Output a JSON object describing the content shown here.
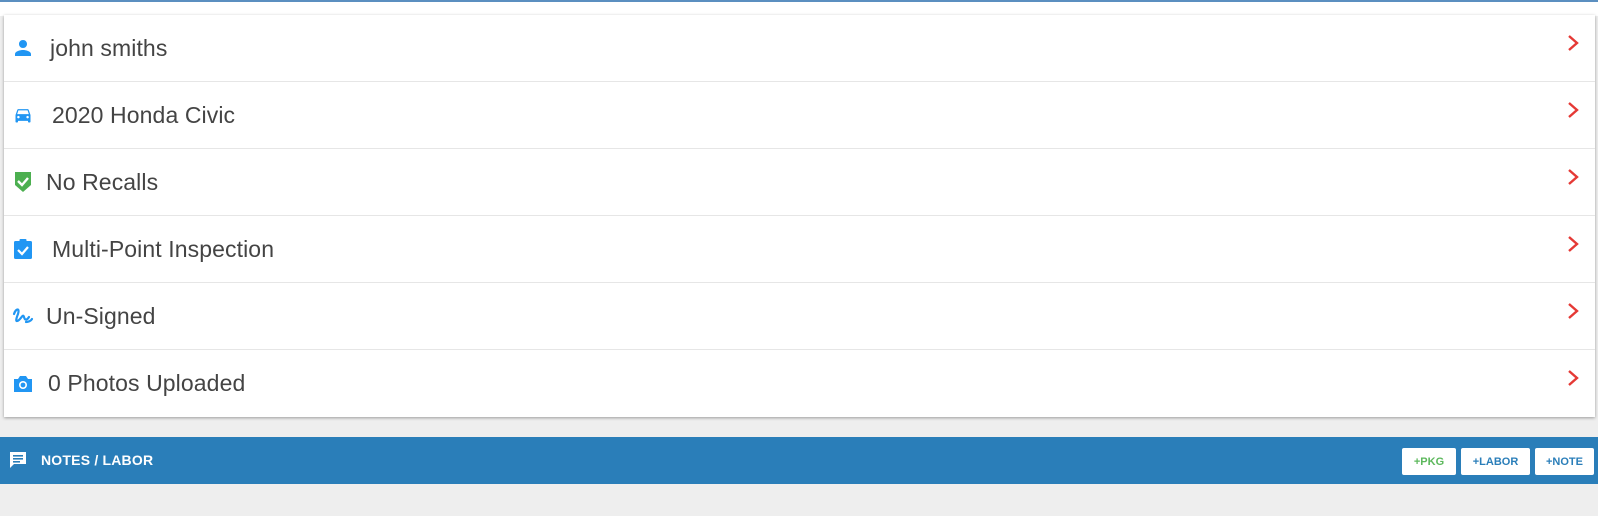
{
  "summary": {
    "rows": [
      {
        "label": "john smiths",
        "icon": "person-icon"
      },
      {
        "label": "2020 Honda Civic",
        "icon": "car-icon"
      },
      {
        "label": "No Recalls",
        "icon": "shield-check-icon"
      },
      {
        "label": "Multi-Point Inspection",
        "icon": "clipboard-check-icon"
      },
      {
        "label": "Un-Signed",
        "icon": "signature-icon"
      },
      {
        "label": "0 Photos Uploaded",
        "icon": "camera-icon"
      }
    ]
  },
  "notes_bar": {
    "title": "NOTES / LABOR",
    "buttons": {
      "pkg": "+PKG",
      "labor": "+LABOR",
      "note": "+NOTE"
    }
  },
  "colors": {
    "icon_blue": "#2196f3",
    "icon_green": "#4caf50",
    "chevron_red": "#e53935",
    "bar_blue": "#2a7eb9",
    "pkg_green": "#5cb85c"
  }
}
